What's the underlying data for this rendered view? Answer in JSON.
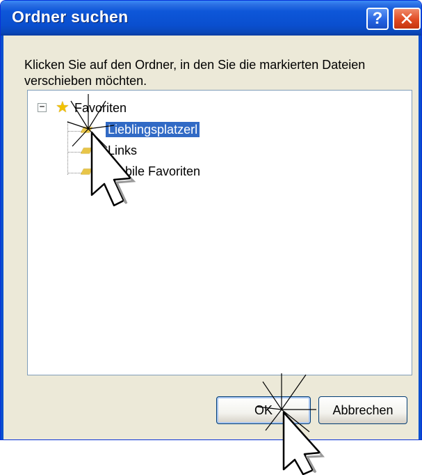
{
  "window": {
    "title": "Ordner suchen",
    "help_label": "?",
    "close_label": "✕"
  },
  "instruction": "Klicken Sie auf den Ordner, in den Sie die markierten Dateien verschieben möchten.",
  "tree": {
    "root": {
      "label": "Favoriten",
      "expander": "−",
      "icon": "star-icon"
    },
    "children": [
      {
        "label": "Lieblingsplatzerl",
        "selected": true,
        "icon": "folder-icon"
      },
      {
        "label": "Links",
        "selected": false,
        "icon": "folder-icon"
      },
      {
        "label": "Mobile Favoriten",
        "selected": false,
        "icon": "folder-icon"
      }
    ]
  },
  "buttons": {
    "ok_label": "OK",
    "cancel_label": "Abbrechen"
  },
  "colors": {
    "titlebar": "#0a4fcf",
    "selection": "#316ac5",
    "dialog_bg": "#ece9d8"
  }
}
